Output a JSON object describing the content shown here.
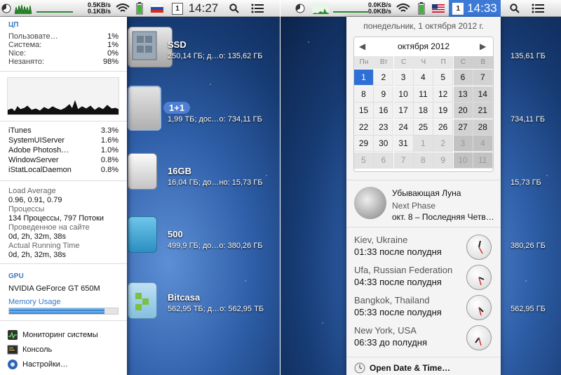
{
  "left": {
    "menubar": {
      "net_up": "0.5KB/s",
      "net_down": "0.1KB/s",
      "time": "14:27",
      "calendar_day": "1"
    },
    "cpu": {
      "title": "ЦП",
      "rows": [
        {
          "label": "Пользовате…",
          "value": "1%"
        },
        {
          "label": "Система:",
          "value": "1%"
        },
        {
          "label": "Nice:",
          "value": "0%"
        },
        {
          "label": "Незанято:",
          "value": "98%"
        }
      ]
    },
    "processes": [
      {
        "name": "iTunes",
        "value": "3.3%"
      },
      {
        "name": "SystemUIServer",
        "value": "1.6%"
      },
      {
        "name": "Adobe Photosh…",
        "value": "1.0%"
      },
      {
        "name": "WindowServer",
        "value": "0.8%"
      },
      {
        "name": "iStatLocalDaemon",
        "value": "0.8%"
      }
    ],
    "load": {
      "load_label": "Load Average",
      "load_value": "0.96, 0.91, 0.79",
      "proc_label": "Процессы",
      "proc_value": "134 Процессы, 797 Потоки",
      "uptime_label": "Проведенное на сайте",
      "uptime_value": "0d, 2h, 32m, 38s",
      "running_label": "Actual Running Time",
      "running_value": "0d, 2h, 32m, 38s"
    },
    "gpu": {
      "title": "GPU",
      "name": "NVIDIA GeForce GT 650M",
      "memory_label": "Memory Usage",
      "memory_fraction": 0.88
    },
    "actions": [
      {
        "label": "Мониторинг системы",
        "icon": "activity-monitor-icon"
      },
      {
        "label": "Консоль",
        "icon": "console-icon"
      },
      {
        "label": "Настройки…",
        "icon": "preferences-icon"
      }
    ],
    "drives": [
      {
        "name": "SSD",
        "info": "250,14 ГБ; д…о: 135,62 ГБ"
      },
      {
        "name": "1+1",
        "info": "1,99 ТБ; дос…о: 734,11 ГБ"
      },
      {
        "name": "16GB",
        "info": "16,04 ГБ; до…но: 15,73 ГБ"
      },
      {
        "name": "500",
        "info": "499,9 ГБ; до…о: 380,26 ГБ"
      },
      {
        "name": "Bitcasa",
        "info": "562,95 ТБ; д…о: 562,95 ТБ"
      }
    ]
  },
  "right": {
    "menubar": {
      "net_up": "0.0KB/s",
      "net_down": "0.0KB/s",
      "time": "14:33",
      "calendar_day": "1"
    },
    "date_header": "понедельник, 1 октября 2012 г.",
    "month_title": "октября 2012",
    "weekdays": [
      "Пн",
      "Вт",
      "С",
      "Ч",
      "П",
      "С",
      "В"
    ],
    "weeks": [
      [
        "1",
        "2",
        "3",
        "4",
        "5",
        "6",
        "7"
      ],
      [
        "8",
        "9",
        "10",
        "11",
        "12",
        "13",
        "14"
      ],
      [
        "15",
        "16",
        "17",
        "18",
        "19",
        "20",
        "21"
      ],
      [
        "22",
        "23",
        "24",
        "25",
        "26",
        "27",
        "28"
      ],
      [
        "29",
        "30",
        "31",
        "1",
        "2",
        "3",
        "4"
      ],
      [
        "5",
        "6",
        "7",
        "8",
        "9",
        "10",
        "11"
      ]
    ],
    "moon": {
      "title": "Убывающая Луна",
      "label": "Next Phase",
      "value": "окт. 8 – Последняя Четв…"
    },
    "world_clocks": [
      {
        "city": "Kiev, Ukraine",
        "time": "01:33 после полудня"
      },
      {
        "city": "Ufa, Russian Federation",
        "time": "04:33 после полудня"
      },
      {
        "city": "Bangkok, Thailand",
        "time": "05:33 после полудня"
      },
      {
        "city": "New York, USA",
        "time": "06:33 до полудня"
      }
    ],
    "open_action": "Open Date & Time…",
    "drive_infos": [
      "135,61 ГБ",
      "734,11 ГБ",
      "15,73 ГБ",
      "380,26 ГБ",
      "562,95 ГБ"
    ]
  },
  "colors": {
    "accent": "#3b78c6",
    "selection": "#3d7ad8",
    "desktop": "#2f5fa8"
  }
}
